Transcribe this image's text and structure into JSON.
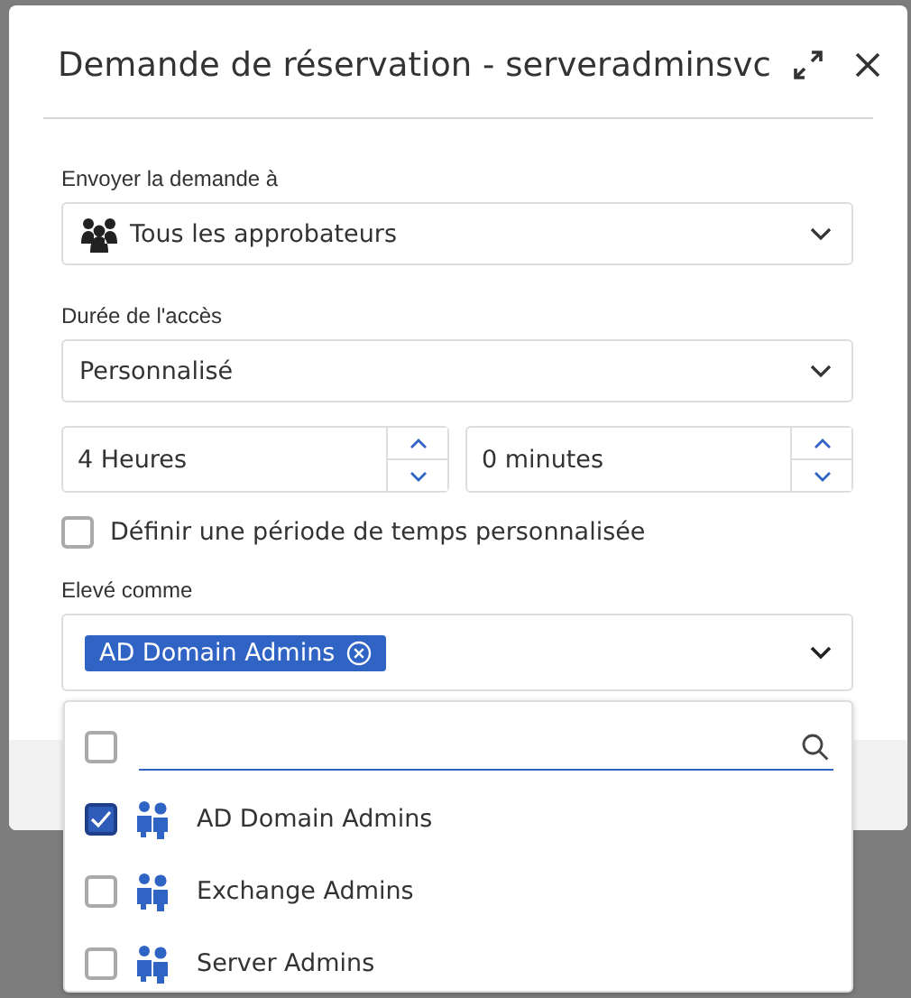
{
  "dialog": {
    "title": "Demande de réservation - serveradminsvc"
  },
  "send_to": {
    "label": "Envoyer la demande à",
    "value": "Tous les approbateurs"
  },
  "duration": {
    "label": "Durée de l'accès",
    "value": "Personnalisé"
  },
  "spinners": [
    {
      "value": "4 Heures"
    },
    {
      "value": "0 minutes"
    }
  ],
  "custom_period": {
    "label": "Définir une période de temps personnalisée",
    "checked": false
  },
  "elevated_as": {
    "label": "Elevé comme",
    "tags": [
      {
        "label": "AD Domain Admins"
      }
    ]
  },
  "dropdown": {
    "select_all_checked": false,
    "items": [
      {
        "label": "AD Domain Admins",
        "checked": true
      },
      {
        "label": "Exchange Admins",
        "checked": false
      },
      {
        "label": "Server Admins",
        "checked": false
      }
    ]
  }
}
